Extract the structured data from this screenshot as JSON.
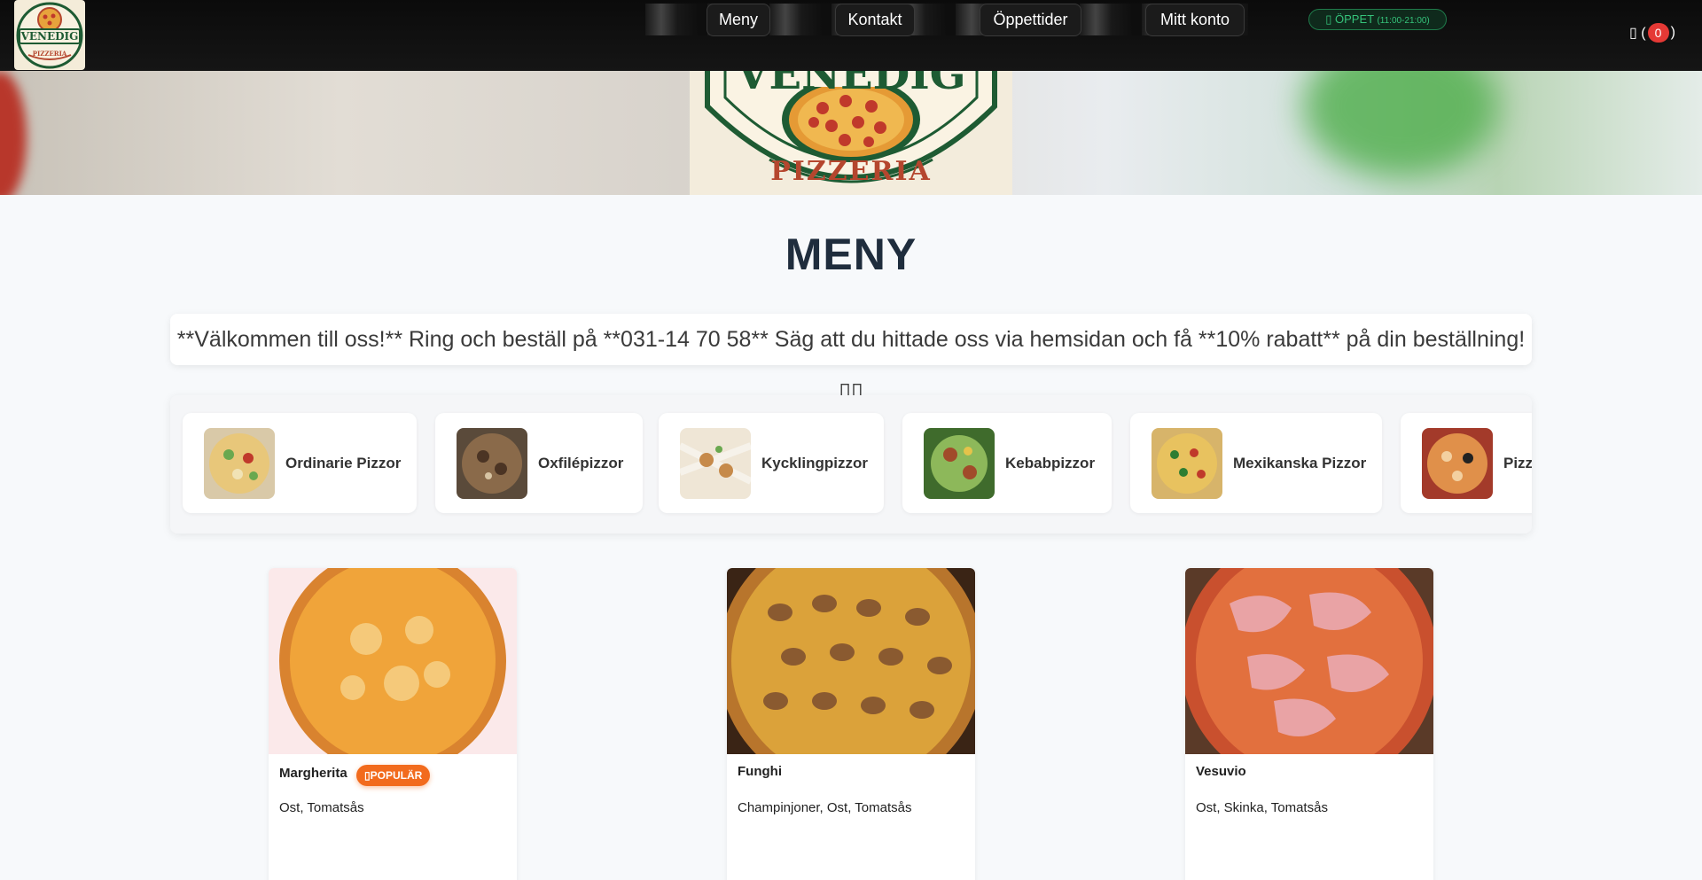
{
  "nav": {
    "logo_text": "VENEDIG",
    "logo_subtext": "PIZZERIA",
    "items": [
      "Meny",
      "Kontakt",
      "Öppettider",
      "Mitt konto"
    ],
    "status": {
      "label": "▯ ÖPPET",
      "hours": "(11:00-21:00)"
    },
    "cart": {
      "icon": "cart-icon",
      "open_paren": "▯ (",
      "count": "0",
      "close_paren": ")"
    }
  },
  "hero": {
    "logo_text": "VENEDIG",
    "logo_subtext": "PIZZERIA"
  },
  "main": {
    "title": "MENY",
    "promo": "**Välkommen till oss!** Ring och beställ på **031-14 70 58** Säg att du hittade oss via hemsidan och få **10% rabatt** på din beställning! ▯▯"
  },
  "categories": [
    {
      "label": "Ordinarie Pizzor"
    },
    {
      "label": "Oxfilépizzor"
    },
    {
      "label": "Kycklingpizzor"
    },
    {
      "label": "Kebabpizzor"
    },
    {
      "label": "Mexikanska Pizzor"
    },
    {
      "label": "Pizz"
    }
  ],
  "products": [
    {
      "name": "Margherita",
      "badge": "▯POPULÄR",
      "desc": "Ost, Tomatsås"
    },
    {
      "name": "Funghi",
      "desc": "Champinjoner, Ost, Tomatsås"
    },
    {
      "name": "Vesuvio",
      "desc": "Ost, Skinka, Tomatsås"
    }
  ],
  "colors": {
    "nav_bg": "#0b0b0b",
    "accent_orange": "#f26b1d",
    "open_green": "#35c27a",
    "cart_badge": "#e53935",
    "title": "#1f2d3d"
  }
}
